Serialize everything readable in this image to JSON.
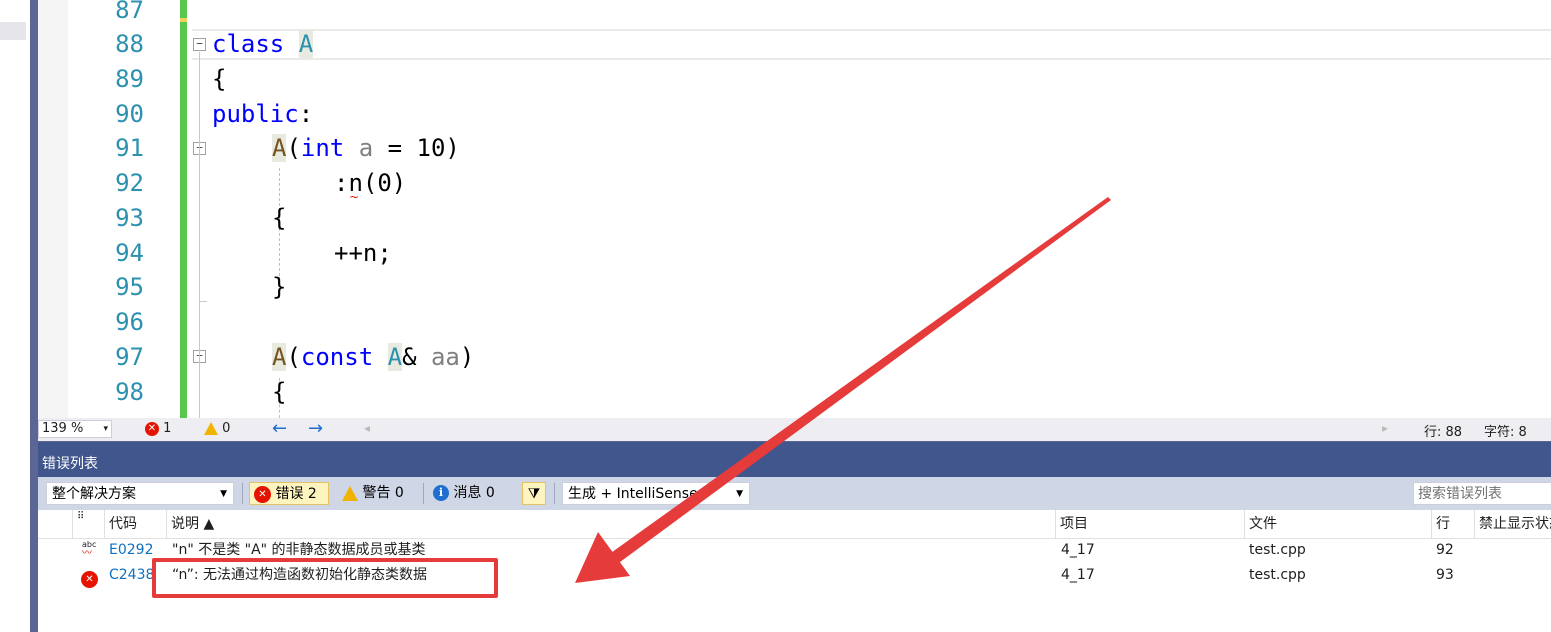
{
  "editor": {
    "line_numbers": [
      "87",
      "88",
      "89",
      "90",
      "91",
      "92",
      "93",
      "94",
      "95",
      "96",
      "97",
      "98"
    ],
    "lines": {
      "l88_kw": "class",
      "l88_name": "A",
      "l89": "{",
      "l90_kw": "public",
      "l90_colon": ":",
      "l91_fn": "A",
      "l91_open": "(",
      "l91_kw": "int",
      "l91_param": "a",
      "l91_rest": " = 10)",
      "l92_pre": ":",
      "l92_n": "n",
      "l92_rest": "(0)",
      "l93": "{",
      "l94": "++n;",
      "l95": "}",
      "l97_fn": "A",
      "l97_open": "(",
      "l97_kw": "const",
      "l97_type": "A",
      "l97_amp": "& ",
      "l97_param": "aa",
      "l97_close": ")",
      "l98": "{"
    },
    "fold_glyph": "−",
    "squiggle_glyph": "~"
  },
  "statusbar": {
    "zoom": "139 %",
    "zoom_caret": "▾",
    "error_count": "1",
    "warning_count": "0",
    "nav_back": "←",
    "nav_forward": "→",
    "scroll_left": "◂",
    "scroll_right": "▸",
    "line_label": "行: 88",
    "char_label": "字符: 8"
  },
  "error_list": {
    "title": "错误列表",
    "scope": "整个解决方案",
    "errors_filter": "错误 2",
    "warnings_filter": "警告 0",
    "messages_filter": "消息 0",
    "source": "生成 + IntelliSense",
    "search_placeholder": "搜索错误列表",
    "columns": {
      "code": "代码",
      "description": "说明 ▲",
      "project": "项目",
      "file": "文件",
      "line": "行",
      "suppression": "禁止显示状态"
    },
    "rows": [
      {
        "icon": "intellisense-error-icon",
        "code": "E0292",
        "description": "\"n\" 不是类 \"A\" 的非静态数据成员或基类",
        "project": "4_17",
        "file": "test.cpp",
        "line": "92"
      },
      {
        "icon": "error-icon",
        "code": "C2438",
        "description": "“n”: 无法通过构造函数初始化静态类数据",
        "project": "4_17",
        "file": "test.cpp",
        "line": "93"
      }
    ]
  },
  "colors": {
    "annotation_red": "#e63b3b",
    "keyword_blue": "#0000ff",
    "type_teal": "#2b91af",
    "panel_blue": "#40568d"
  }
}
